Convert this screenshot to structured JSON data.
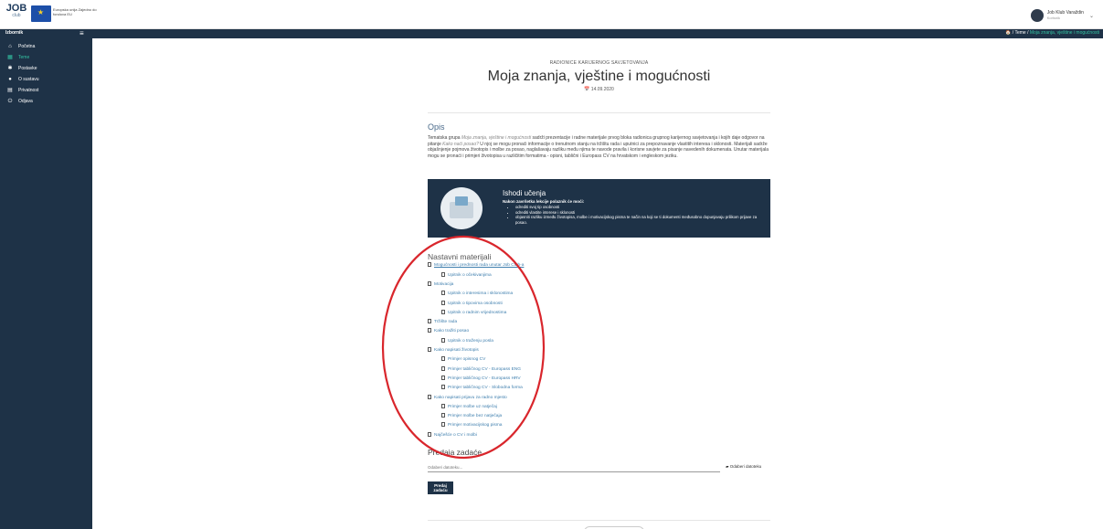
{
  "header": {
    "logo": "JOB",
    "logo_sub": "club",
    "eu_text": "Europska unija Zajedno do fondova EU",
    "user_name": "Job Klub Varaždin",
    "user_role": "Korisnik"
  },
  "subheader": {
    "brand": "Izbornik",
    "breadcrumb_home": "🏠 /",
    "breadcrumb_tema": "Teme",
    "breadcrumb_sep": "/",
    "breadcrumb_current": "Moja znanja, vještine i mogućnosti"
  },
  "sidebar": {
    "items": [
      {
        "label": "Početna",
        "icon": "home-icon",
        "glyph": "⌂"
      },
      {
        "label": "Teme",
        "icon": "topics-icon",
        "glyph": "▦"
      },
      {
        "label": "Postavke",
        "icon": "settings-icon",
        "glyph": "✱"
      },
      {
        "label": "O sustavu",
        "icon": "info-icon",
        "glyph": "●"
      },
      {
        "label": "Privatnost",
        "icon": "document-icon",
        "glyph": "▤"
      },
      {
        "label": "Odjava",
        "icon": "power-icon",
        "glyph": "⏻"
      }
    ],
    "active_index": 1
  },
  "page": {
    "overline": "RADIONICE KARIJERNOG SAVJETOVANJA",
    "title": "Moja znanja, vještine i mogućnosti",
    "date": "📅 14.09.2020",
    "opis_title": "Opis",
    "opis_text_1": "Tematska grupa ",
    "opis_italic_1": "Moja znanja, vještine i mogućnosti",
    "opis_text_2": " sadrži prezentacije i radne materijale prvog bloka radionica grupnog karijernog savjetovanja i kojih daje odgovor na pitanje ",
    "opis_italic_2": "Kako naći posao?",
    "opis_text_3": " U njoj se mogu pronaći informacije o trenutnom stanju na tržištu rada i uputnici za prepoznavanje vlastitih interesa i sklonosti. Materijali sadrže objašnjenje pojmova životopis i molbe za posao, naglašavaju razliku među njima te navode pravila i korisne savjete za pisanje navedenih dokumenata. Unutar materijala mogu se pronaći i primjeri životopisa u različitim formatima - opisni, tablični i Europass CV na hrvatskom i engleskom jeziku."
  },
  "outcomes": {
    "title": "Ishodi učenja",
    "intro": "Nakon završetka lekcije polaznik će moći:",
    "items": [
      "odrediti svoj tip osobnosti",
      "odrediti vlastite interese i sklonosti",
      "objasniti razliku između životopisa, molbe i motivacijskog pisma te način na koji se ti dokumenti međusobno dopunjavaju prilikom prijave za posao."
    ]
  },
  "materials": {
    "title": "Nastavni materijali",
    "items": [
      {
        "label": "Mogućnosti i prednosti rada unutar Job Club-a",
        "level": 1,
        "underline": true
      },
      {
        "label": "Upitnik o očekivanjima",
        "level": 2
      },
      {
        "label": "Motivacija",
        "level": 1
      },
      {
        "label": "Upitnik o interesima i sklonostima",
        "level": 2
      },
      {
        "label": "Upitnik o tipovima osobnosti",
        "level": 2
      },
      {
        "label": "Upitnik o radnim vrijednostima",
        "level": 2
      },
      {
        "label": "Tržište rada",
        "level": 1
      },
      {
        "label": "Kako tražiti posao",
        "level": 1
      },
      {
        "label": "Upitnik o traženju posla",
        "level": 2
      },
      {
        "label": "Kako napisati životopis",
        "level": 1
      },
      {
        "label": "Primjer opisnog CV",
        "level": 2
      },
      {
        "label": "Primjer tabličnog CV - Europass ENG",
        "level": 2
      },
      {
        "label": "Primjer tabličnog CV - Europass HRV",
        "level": 2
      },
      {
        "label": "Primjer tabličnog CV - Slobodna forma",
        "level": 2
      },
      {
        "label": "Kako napisati prijavu za radno mjesto",
        "level": 1
      },
      {
        "label": "Primjer molbe uz natječaj",
        "level": 2
      },
      {
        "label": "Primjer molbe bez natječaja",
        "level": 2
      },
      {
        "label": "Primjer motivacijskog pisma",
        "level": 2
      },
      {
        "label": "Najčešće o CV i molbi",
        "level": 1
      }
    ]
  },
  "submission": {
    "title": "Predaja zadaće",
    "placeholder": "Odaberi datoteku...",
    "choose_label": "Odaberi datoteku",
    "submit_label": "Predaj zadaću"
  },
  "colors": {
    "sidebar_bg": "#1e3247",
    "accent": "#33c3a3",
    "link": "#3f7fae",
    "annotation": "#d9262c"
  }
}
